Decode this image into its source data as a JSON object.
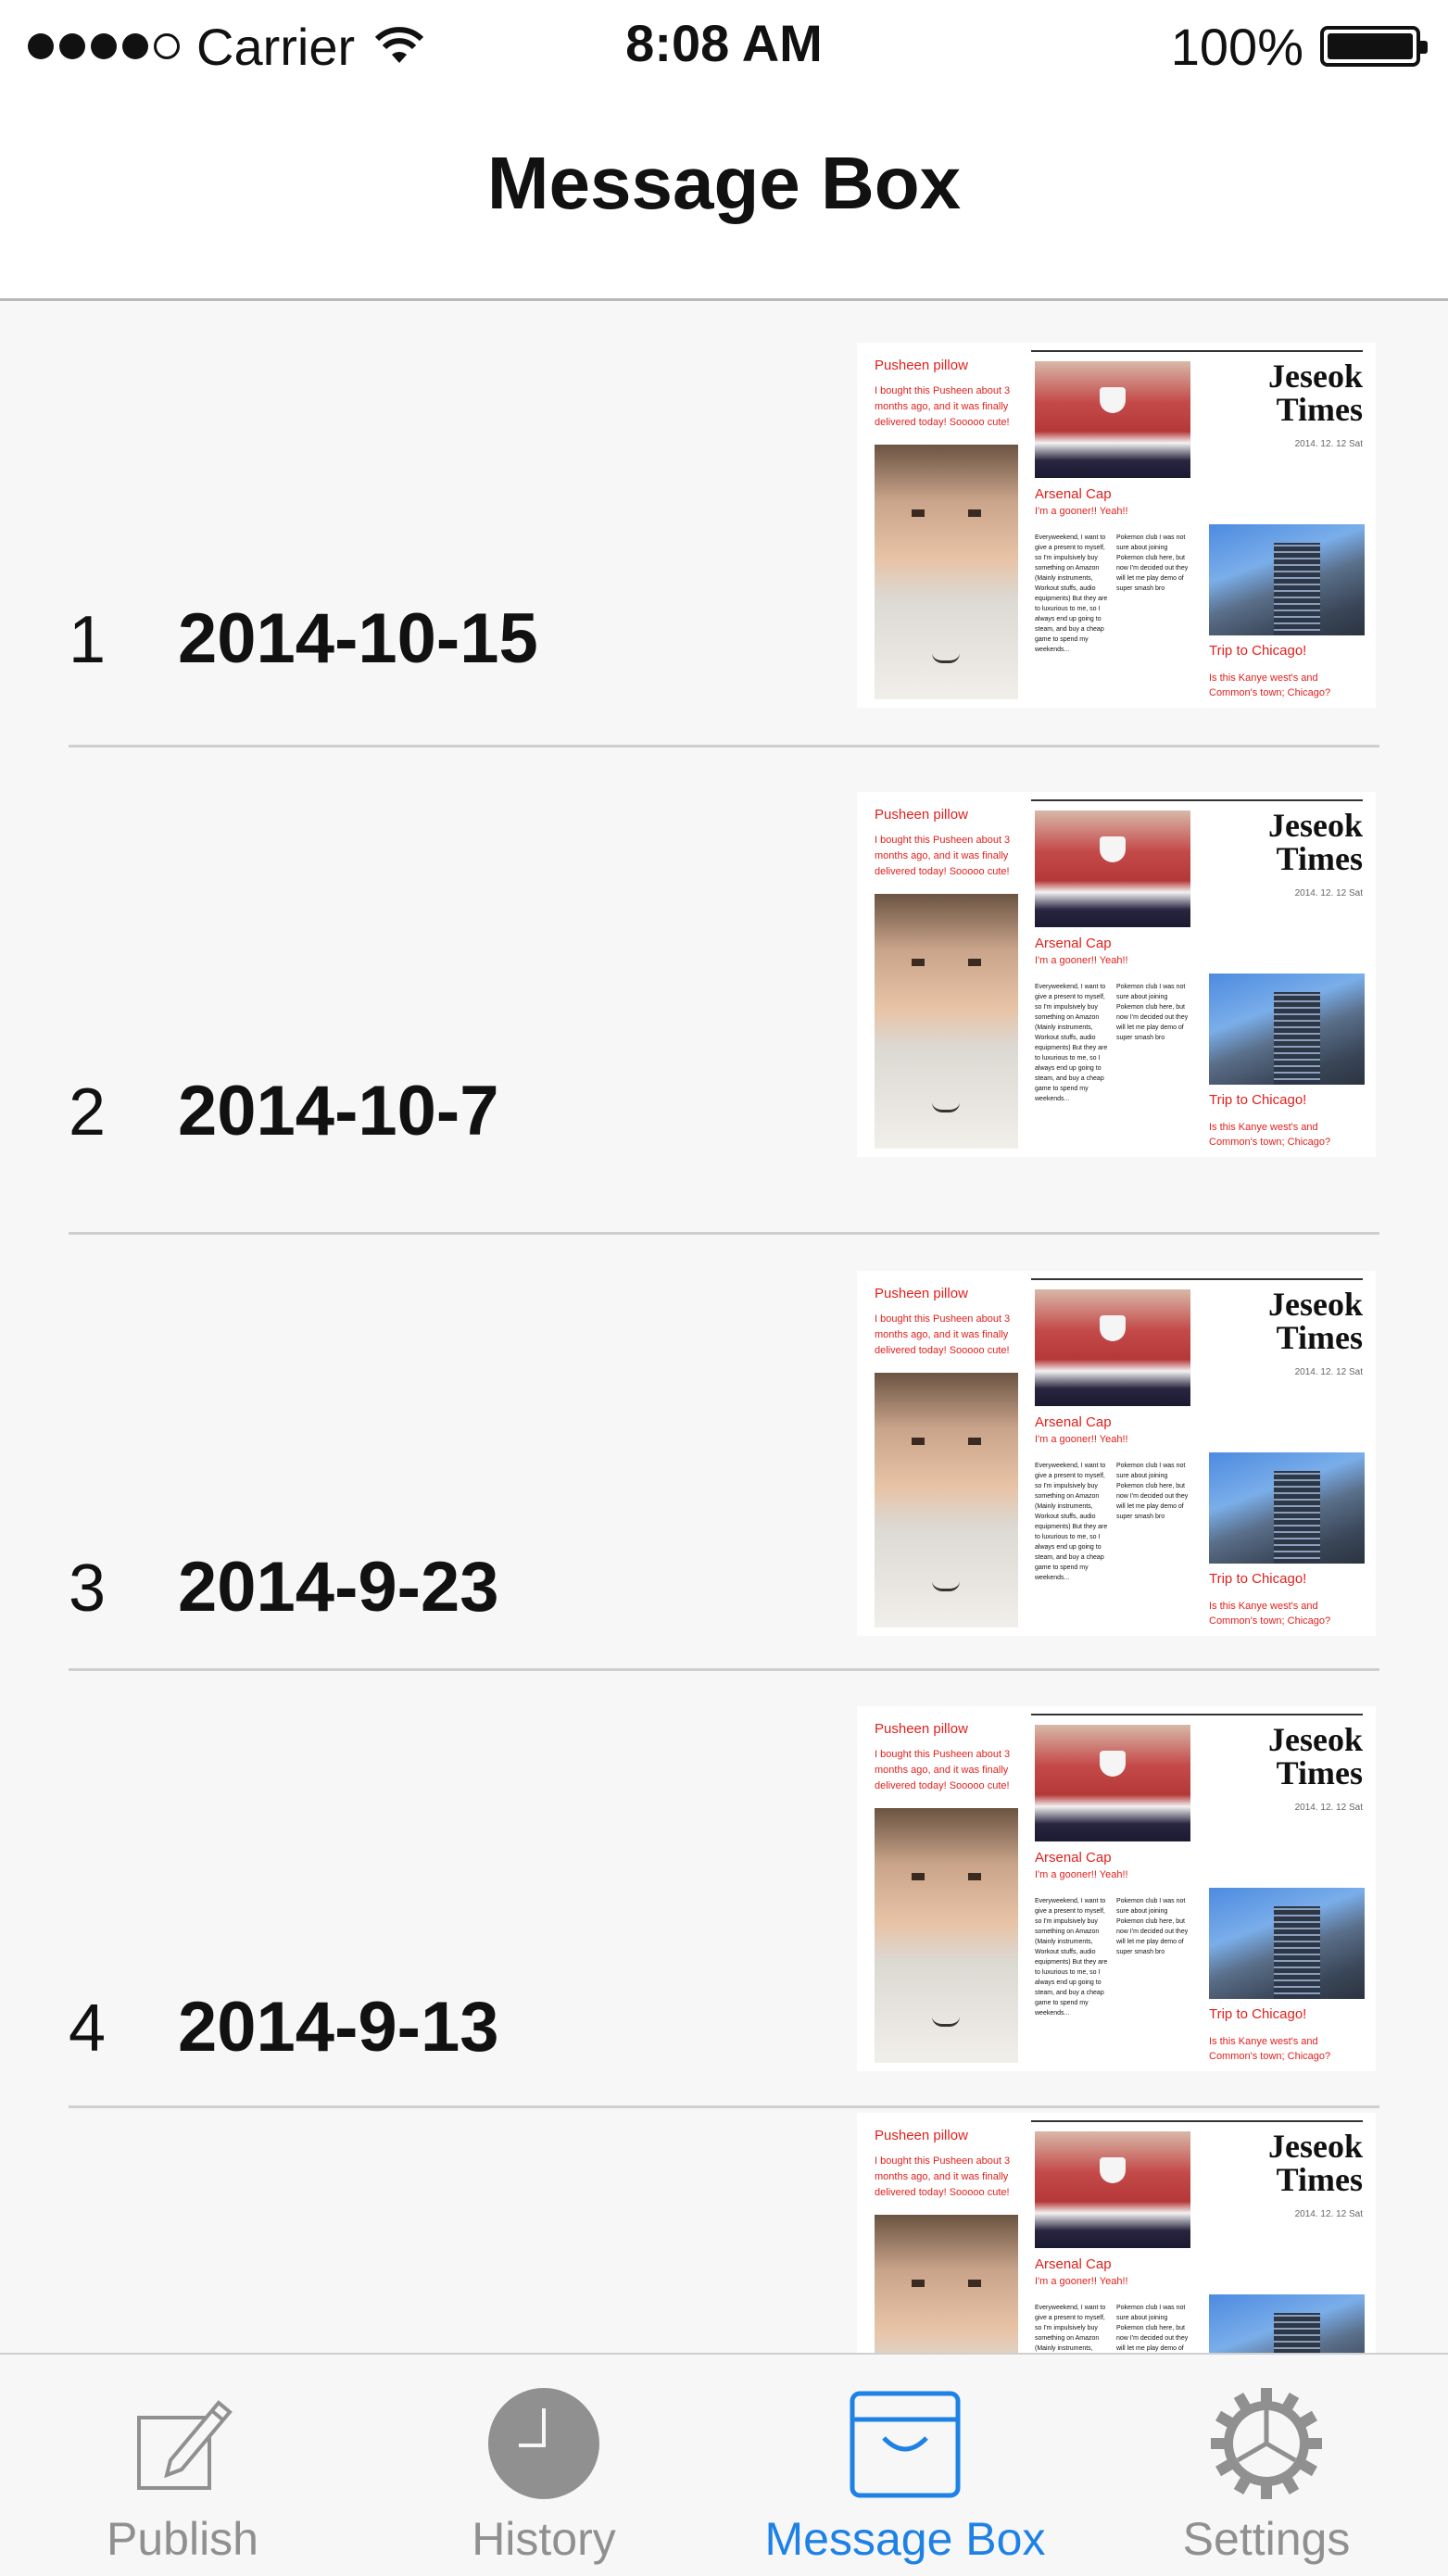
{
  "status_bar": {
    "carrier": "Carrier",
    "time": "8:08 AM",
    "battery": "100%",
    "signal_bars": 4
  },
  "nav": {
    "title": "Message Box"
  },
  "rows": [
    {
      "index": "1",
      "date": "2014-10-15"
    },
    {
      "index": "2",
      "date": "2014-10-7"
    },
    {
      "index": "3",
      "date": "2014-9-23"
    },
    {
      "index": "4",
      "date": "2014-9-13"
    }
  ],
  "thumbnail": {
    "pillow_title": "Pusheen pillow",
    "pillow_text": "I bought this Pusheen about 3 months ago, and it was finally delivered today! Sooooo cute!",
    "paper_title_line1": "Jeseok",
    "paper_title_line2": "Times",
    "paper_date": "2014. 12. 12 Sat",
    "cap_title": "Arsenal Cap",
    "cap_subtitle": "I'm a gooner!! Yeah!!",
    "col1_text": "Everyweekend, I want to give a present to myself, so I'm impulsively buy something on Amazon (Mainly instruments, Workout stuffs, audio equipments) But they are to luxurious to me, so I always end up going to steam, and buy a cheap game to spend my weekends...",
    "col2_text": "Pokemon club I was not sure about joining Pokemon club here, but now I'm decided out they will let me play demo of super smash bro",
    "trip_title": "Trip to Chicago!",
    "trip_text": "Is this Kanye west's and Common's town; Chicago?"
  },
  "tabs": [
    {
      "label": "Publish",
      "icon": "compose-icon",
      "active": false
    },
    {
      "label": "History",
      "icon": "clock-icon",
      "active": false
    },
    {
      "label": "Message Box",
      "icon": "inbox-tray-icon",
      "active": true
    },
    {
      "label": "Settings",
      "icon": "gear-icon",
      "active": false
    }
  ],
  "colors": {
    "accent": "#1a7fe6",
    "inactive": "#8e8e8e",
    "newspaper_red": "#e0201c"
  }
}
